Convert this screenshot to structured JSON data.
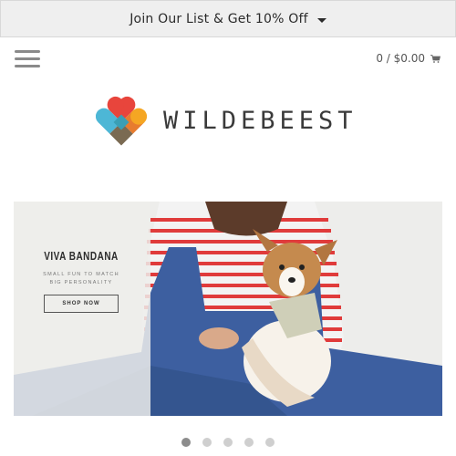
{
  "promo": {
    "text": "Join Our List & Get 10% Off",
    "icon": "chevron-down-icon"
  },
  "header": {
    "menu_icon": "hamburger-menu-icon",
    "cart": {
      "label": "0 / $0.00",
      "icon": "cart-icon"
    }
  },
  "logo": {
    "text": "WILDEBEEST",
    "colors": [
      "#e8453c",
      "#f5a623",
      "#4db7d6",
      "#7a6a52"
    ]
  },
  "hero": {
    "title": "VIVA BANDANA",
    "subtitle_line1": "SMALL FUN TO MATCH",
    "subtitle_line2": "BIG PERSONALITY",
    "button_label": "SHOP NOW"
  },
  "slideshow": {
    "count": 5,
    "active": 1
  }
}
